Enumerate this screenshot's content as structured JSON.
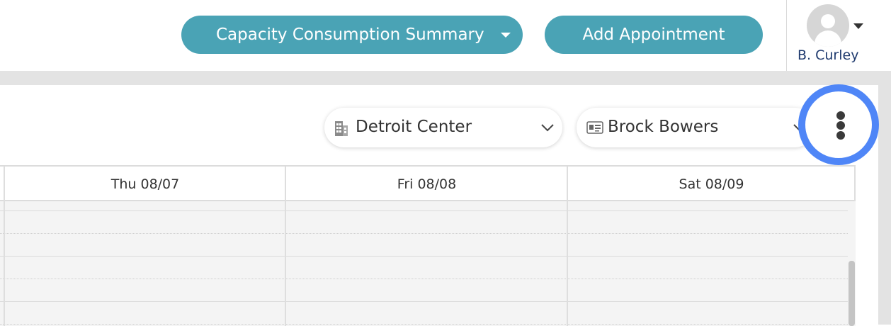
{
  "header": {
    "summary_button": "Capacity Consumption Summary",
    "add_button": "Add Appointment",
    "user_name": "B. Curley"
  },
  "filters": {
    "location": "Detroit Center",
    "person": "Brock Bowers"
  },
  "calendar": {
    "columns": [
      "Thu 08/07",
      "Fri 08/08",
      "Sat 08/09"
    ]
  },
  "colors": {
    "primary_button": "#4aa3b5",
    "highlight_ring": "#4f86f7",
    "username_text": "#1f3a6e"
  },
  "icons": [
    "caret-down-icon",
    "avatar-icon",
    "building-icon",
    "id-card-icon",
    "chevron-down-icon",
    "more-vertical-icon"
  ]
}
